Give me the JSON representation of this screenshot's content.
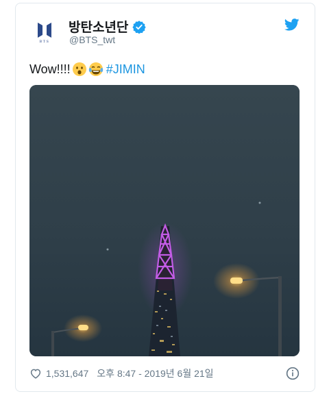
{
  "tweet": {
    "display_name": "방탄소년단",
    "handle": "@BTS_twt",
    "text": "Wow!!!!",
    "hashtag": "#JIMIN",
    "avatar_text": "BTS",
    "like_count": "1,531,647",
    "timestamp": "오후 8:47 - 2019년 6월 21일",
    "icons": [
      "bts-logo-icon",
      "verified-badge-icon",
      "twitter-bird-icon",
      "surprised-face-emoji",
      "tears-of-joy-emoji",
      "heart-icon",
      "info-icon"
    ]
  },
  "colors": {
    "twitter_blue": "#1da1f2",
    "hashtag": "#1b95e0",
    "secondary_text": "#657786",
    "tower_light": "#b14fd8",
    "sky": "#2e3f4a"
  }
}
